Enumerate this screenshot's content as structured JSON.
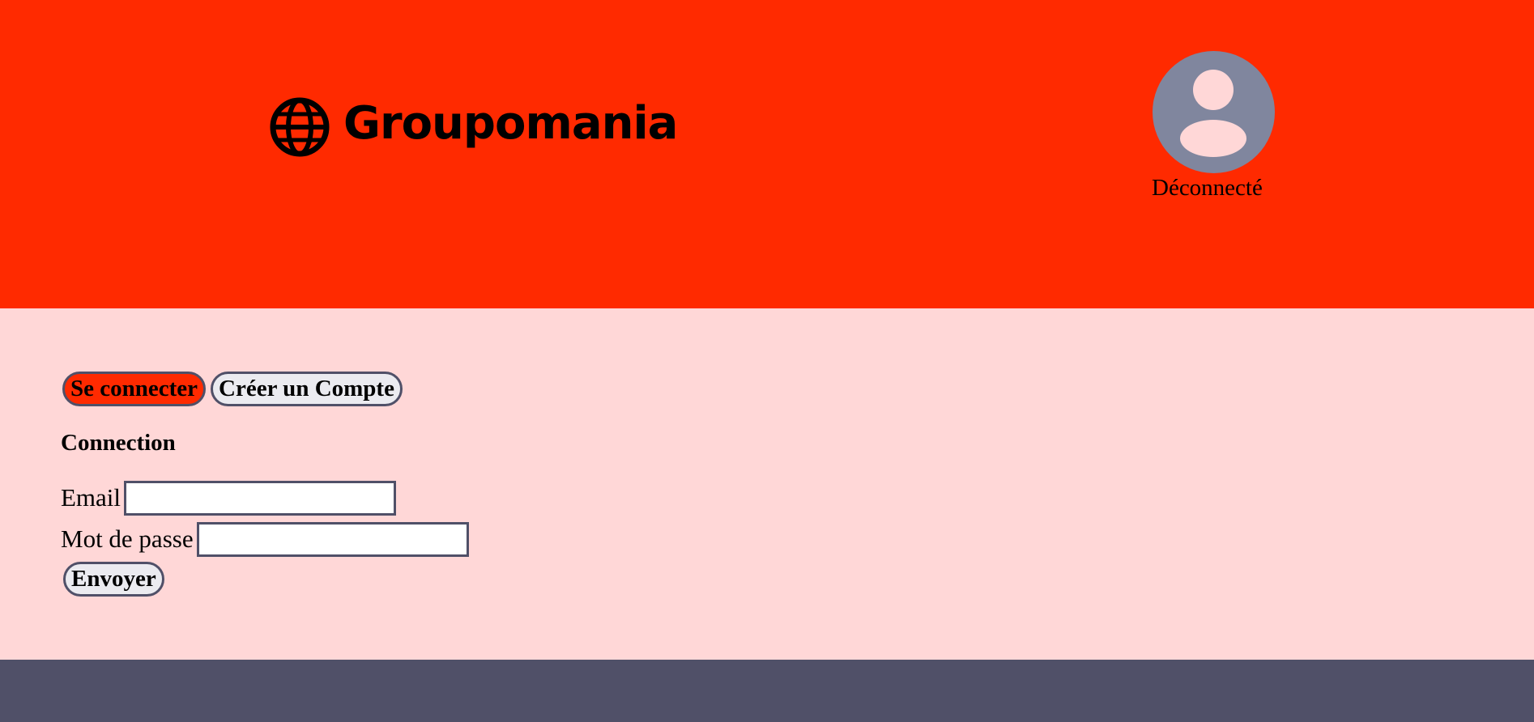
{
  "header": {
    "logo_text": "Groupomania",
    "logo_icon": "globe-icon",
    "user_icon": "user-avatar-icon",
    "status": "Déconnecté"
  },
  "tabs": {
    "login_label": "Se connecter",
    "signup_label": "Créer un Compte",
    "active": "login"
  },
  "form": {
    "title": "Connection",
    "email_label": "Email",
    "email_value": "",
    "password_label": "Mot de passe",
    "password_value": "",
    "submit_label": "Envoyer"
  },
  "colors": {
    "header_bg": "#ff2a00",
    "main_bg": "#ffd7d7",
    "footer_bg": "#505068",
    "avatar_bg": "#80869e",
    "accent": "#ff2a00"
  }
}
